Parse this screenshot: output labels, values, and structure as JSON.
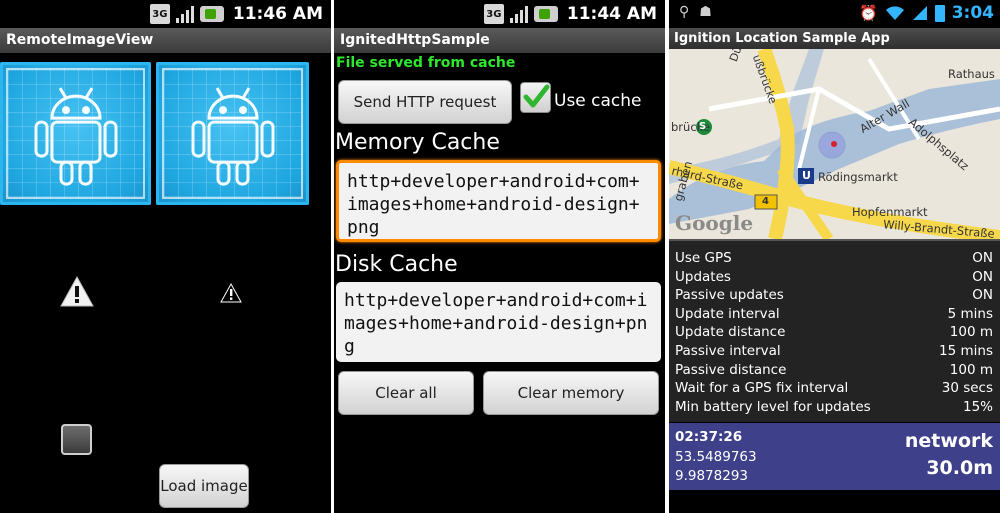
{
  "screen1": {
    "status_time": "11:46 AM",
    "network": "3G",
    "title": "RemoteImageView",
    "load_button": "Load image"
  },
  "screen2": {
    "status_time": "11:44 AM",
    "network": "3G",
    "title": "IgnitedHttpSample",
    "cache_message": "File served from cache",
    "send_button": "Send HTTP request",
    "use_cache_label": "Use cache",
    "use_cache_checked": true,
    "memory_cache_heading": "Memory Cache",
    "memory_cache_value": "http+developer+android+com+images+home+android-design+png",
    "disk_cache_heading": "Disk Cache",
    "disk_cache_value": "http+developer+android+com+images+home+android-design+png",
    "clear_all_button": "Clear all",
    "clear_memory_button": "Clear memory"
  },
  "screen3": {
    "status_time": "3:04",
    "title": "Ignition Location Sample App",
    "map_labels": {
      "rathaus": "Rathaus",
      "dusternstrasse": "Düsternstraße",
      "brucke": "brücke",
      "alter_wall": "Alter Wall",
      "adolphsplatz": "Adolphsplatz",
      "rodingsmarkt": "Rödingsmarkt",
      "ludwig_erhard": "rhard-Straße",
      "hopfenmarkt": "Hopfenmarkt",
      "willy_brandt": "Willy-Brandt-Straße",
      "road_number": "4",
      "google": "Google",
      "ubahn": "U",
      "sbahn": "S",
      "strasse_top": "ußbrücke",
      "graben": "graben"
    },
    "settings": [
      {
        "label": "Use GPS",
        "value": "ON"
      },
      {
        "label": "Updates",
        "value": "ON"
      },
      {
        "label": "Passive updates",
        "value": "ON"
      },
      {
        "label": "Update interval",
        "value": "5 mins"
      },
      {
        "label": "Update distance",
        "value": "100 m"
      },
      {
        "label": "Passive interval",
        "value": "15 mins"
      },
      {
        "label": "Passive distance",
        "value": "100 m"
      },
      {
        "label": "Wait for a GPS fix interval",
        "value": "30 secs"
      },
      {
        "label": "Min battery level for updates",
        "value": "15%"
      }
    ],
    "fix_time": "02:37:26",
    "latitude": "53.5489763",
    "longitude": "9.9878293",
    "provider": "network",
    "accuracy": "30.0m"
  },
  "colors": {
    "cache_message": "#2ee82e",
    "focus_orange": "#ff8a00",
    "status_panel": "#3e418a",
    "image_blue": "#1fa7e0"
  }
}
